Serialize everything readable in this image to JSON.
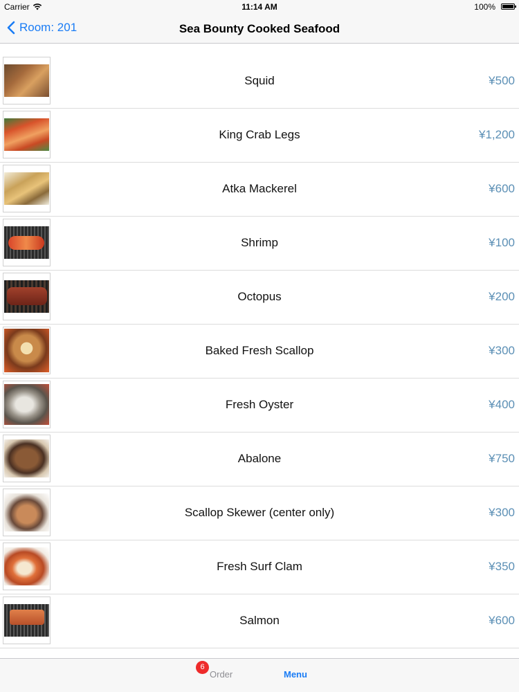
{
  "status_bar": {
    "carrier": "Carrier",
    "time": "11:14 AM",
    "battery": "100%"
  },
  "nav": {
    "back_label": "Room: 201",
    "title": "Sea Bounty Cooked Seafood"
  },
  "items": [
    {
      "name": "Squid",
      "price": "¥500"
    },
    {
      "name": "King Crab Legs",
      "price": "¥1,200"
    },
    {
      "name": "Atka Mackerel",
      "price": "¥600"
    },
    {
      "name": "Shrimp",
      "price": "¥100"
    },
    {
      "name": "Octopus",
      "price": "¥200"
    },
    {
      "name": "Baked Fresh Scallop",
      "price": "¥300"
    },
    {
      "name": "Fresh Oyster",
      "price": "¥400"
    },
    {
      "name": "Abalone",
      "price": "¥750"
    },
    {
      "name": "Scallop Skewer (center only)",
      "price": "¥300"
    },
    {
      "name": "Fresh Surf Clam",
      "price": "¥350"
    },
    {
      "name": "Salmon",
      "price": "¥600"
    }
  ],
  "tab_bar": {
    "order_label": "Order",
    "order_badge": "6",
    "menu_label": "Menu"
  },
  "colors": {
    "accent": "#1a7cf5",
    "price": "#5b8fb5",
    "badge": "#ee2b2b"
  }
}
